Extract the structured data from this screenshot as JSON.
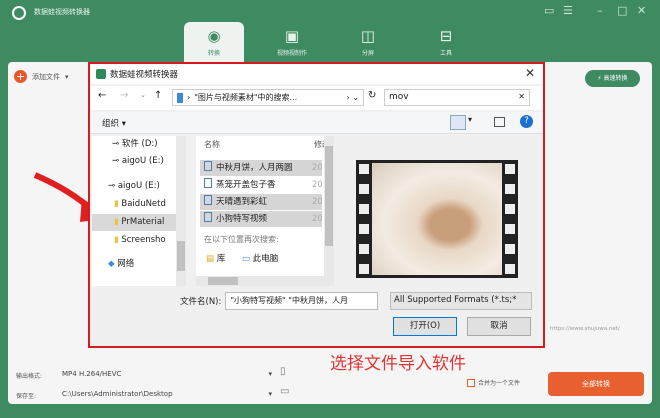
{
  "app": {
    "title": "数据蛙视频转换器",
    "tabs": [
      {
        "label": "转换",
        "icon": "convert-icon",
        "active": true
      },
      {
        "label": "视频视制作",
        "icon": "tv-icon"
      },
      {
        "label": "分屏",
        "icon": "split-screen-icon"
      },
      {
        "label": "工具",
        "icon": "toolbox-icon"
      }
    ],
    "add_file": "添加文件",
    "fast_convert": "高速转换",
    "watermark_url": "https://www.shujuwa.net/"
  },
  "dialog": {
    "title": "数据蛙视频转换器",
    "address": "\"图片与视频素材\"中的搜索...",
    "search_value": "mov",
    "organize": "组织 ▾",
    "nav_items": [
      {
        "label": "软件 (D:)",
        "icon": "drive-icon"
      },
      {
        "label": "aigoU (E:)",
        "icon": "drive-icon"
      },
      {
        "label": "aigoU (E:)",
        "icon": "drive-icon"
      },
      {
        "label": "BaiduNetd",
        "icon": "folder-icon"
      },
      {
        "label": "PrMaterial",
        "icon": "folder-icon",
        "selected": true
      },
      {
        "label": "Screensho",
        "icon": "folder-icon"
      },
      {
        "label": "网络",
        "icon": "network-icon"
      }
    ],
    "columns": {
      "name": "名称",
      "modified": "修改"
    },
    "files": [
      {
        "name": "中秋月饼，人月两圆",
        "date": "202",
        "selected": true
      },
      {
        "name": "蒸笼开盖包子香",
        "date": "202"
      },
      {
        "name": "天晴遇到彩虹",
        "date": "202",
        "selected": true
      },
      {
        "name": "小狗特写视频",
        "date": "202",
        "selected": true
      }
    ],
    "search_again": "在以下位置再次搜索:",
    "search_locations": [
      "库",
      "此电脑"
    ],
    "filename_label": "文件名(N):",
    "filename_value": "\"小狗特写视频\" \"中秋月饼，人月",
    "filter": "All Supported Formats (*.ts;*",
    "open": "打开(O)",
    "cancel": "取消"
  },
  "caption": "选择文件导入软件",
  "bottom": {
    "output_format_label": "输出格式:",
    "output_format": "MP4 H.264/HEVC",
    "save_to_label": "保存至:",
    "save_path": "C:\\Users\\Administrator\\Desktop",
    "merge": "合并为一个文件",
    "convert_all": "全部转换"
  },
  "colors": {
    "brand": "#3f8b61",
    "accent": "#e8602f",
    "highlight": "#d71920"
  }
}
